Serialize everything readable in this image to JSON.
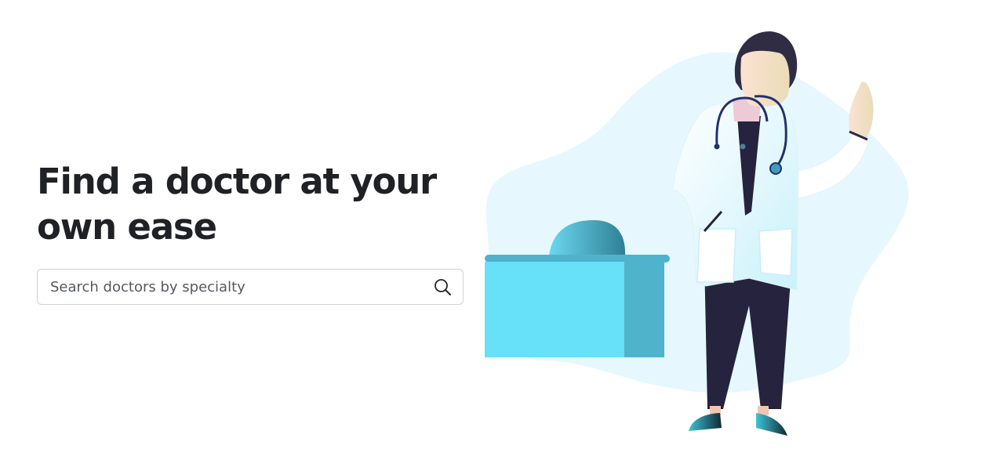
{
  "hero": {
    "title": "Find a doctor at your own ease"
  },
  "search": {
    "placeholder": "Search doctors by specialty",
    "icon": "search-icon"
  },
  "illustration": {
    "subject": "doctor-with-desk",
    "colors": {
      "blob": "#e6f8fd",
      "desk": "#67e0fa",
      "desk_shade": "#4fb3cb",
      "trousers": "#25233d",
      "hair": "#2f2c43",
      "stethoscope": "#24306b"
    }
  }
}
